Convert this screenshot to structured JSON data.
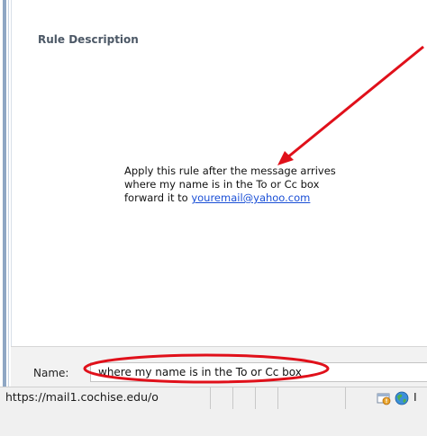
{
  "rule_description": {
    "title": "Rule Description",
    "line1": "Apply this rule after the message arrives",
    "line2": "where my name is in the To or Cc box",
    "line3_prefix": "forward it to ",
    "email_link": "youremail@yahoo.com"
  },
  "name_field": {
    "label": "Name:",
    "value": "where my name is in the To or Cc box"
  },
  "status_bar": {
    "url": "https://mail1.cochise.edu/o",
    "zone_text": "I"
  },
  "colors": {
    "annotation": "#e0101a",
    "link": "#1a4fd6"
  },
  "icons": [
    "security-icon",
    "globe-icon"
  ]
}
